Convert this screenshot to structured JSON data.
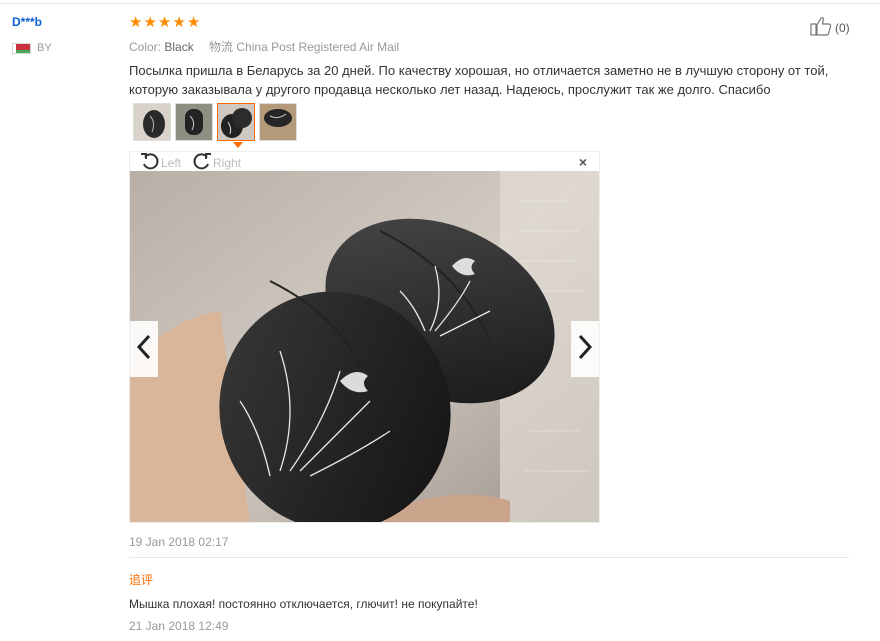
{
  "reviewer": {
    "name": "D***b",
    "country": "BY",
    "flag": "belarus-flag"
  },
  "rating": {
    "stars": 5,
    "max": 5,
    "color": "#ff8c00"
  },
  "meta": {
    "color_label": "Color:",
    "color_value": "Black",
    "shipping_label": "物流",
    "shipping_value": "China Post Registered Air Mail"
  },
  "helpful": {
    "count": "(0)",
    "icon": "thumbs-up-icon"
  },
  "review_text": "Посылка пришла в Беларусь за 20 дней. По качеству хорошая, но отличается заметно не в лучшую сторону от той, которую заказывала у другого продавца несколько лет назад. Надеюсь, прослужит так же долго. Спасибо",
  "photos": {
    "count": 4,
    "selected_index": 3
  },
  "viewer": {
    "rotate_left_label": "Left",
    "rotate_right_label": "Right",
    "close_symbol": "×",
    "prev_symbol": "‹",
    "next_symbol": "›"
  },
  "review_date": "19 Jan 2018 02:17",
  "additional_feedback": {
    "label": "追评",
    "text": "Мышка плохая! постоянно отключается, глючит! не покупайте!",
    "date": "21 Jan 2018 12:49"
  },
  "colors": {
    "accent": "#ff6a00",
    "username": "#0b5fd6",
    "muted": "#999999"
  }
}
